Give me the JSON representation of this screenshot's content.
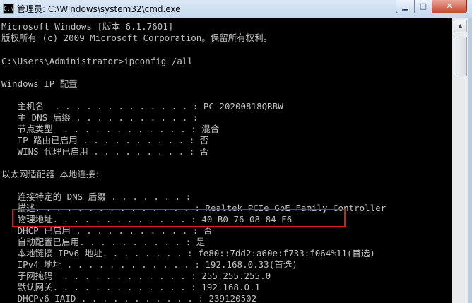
{
  "window": {
    "title": "管理员: C:\\Windows\\system32\\cmd.exe",
    "icon_text": "C:\\",
    "minimize_glyph": "▁",
    "maximize_glyph": "□",
    "close_glyph": "✕"
  },
  "scrollbar": {
    "up_arrow": "▲"
  },
  "console_lines": [
    "Microsoft Windows [版本 6.1.7601]",
    "版权所有 (c) 2009 Microsoft Corporation。保留所有权利。",
    "",
    "C:\\Users\\Administrator>ipconfig /all",
    "",
    "Windows IP 配置",
    "",
    "   主机名  . . . . . . . . . . . . . : PC-20200818QRBW",
    "   主 DNS 后缀 . . . . . . . . . . . :",
    "   节点类型  . . . . . . . . . . . . : 混合",
    "   IP 路由已启用 . . . . . . . . . . : 否",
    "   WINS 代理已启用 . . . . . . . . . : 否",
    "",
    "以太网适配器 本地连接:",
    "",
    "   连接特定的 DNS 后缀 . . . . . . . :",
    "   描述. . . . . . . . . . . . . . . : Realtek PCIe GbE Family Controller",
    "   物理地址. . . . . . . . . . . . . : 40-B0-76-08-84-F6",
    "   DHCP 已启用 . . . . . . . . . . . : 否",
    "   自动配置已启用. . . . . . . . . . : 是",
    "   本地链接 IPv6 地址. . . . . . . . : fe80::7dd2:a60e:f733:f064%11(首选)",
    "   IPv4 地址 . . . . . . . . . . . . : 192.168.0.33(首选)",
    "   子网掩码  . . . . . . . . . . . . : 255.255.255.0",
    "   默认网关. . . . . . . . . . . . . : 192.168.0.1",
    "   DHCPv6 IAID . . . . . . . . . . . : 239120502"
  ]
}
